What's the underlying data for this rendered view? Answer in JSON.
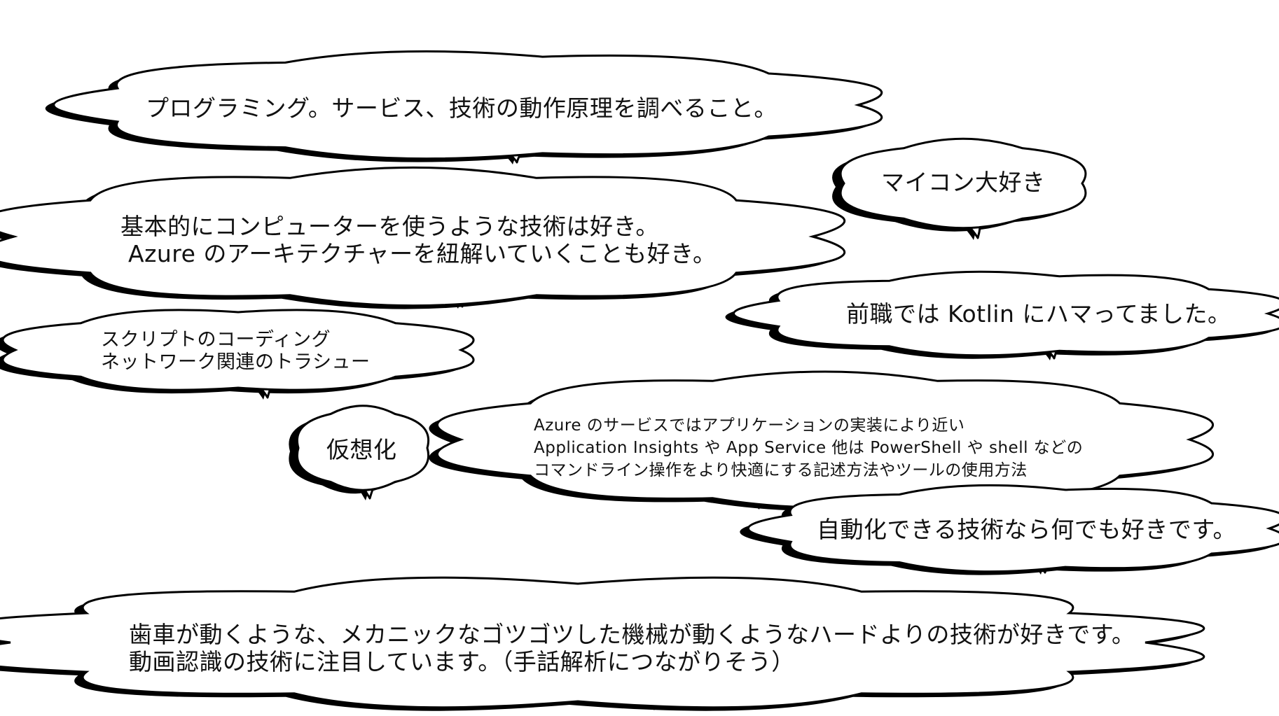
{
  "bubbles": [
    {
      "id": "programming",
      "text": "プログラミング。サービス、技術の動作原理を調べること。"
    },
    {
      "id": "microcontroller",
      "text": "マイコン大好き"
    },
    {
      "id": "computer-tech",
      "text": "基本的にコンピューターを使うような技術は好き。\n Azure のアーキテクチャーを紐解いていくことも好き。"
    },
    {
      "id": "kotlin",
      "text": "前職では Kotlin にハマってました。"
    },
    {
      "id": "scripting",
      "text": "スクリプトのコーディング\nネットワーク関連のトラシュー"
    },
    {
      "id": "virtualization",
      "text": "仮想化"
    },
    {
      "id": "azure-services",
      "text": "Azure のサービスではアプリケーションの実装により近い\nApplication Insights や App Service 他は PowerShell や shell などの\nコマンドライン操作をより快適にする記述方法やツールの使用方法"
    },
    {
      "id": "automation",
      "text": "自動化できる技術なら何でも好きです。"
    },
    {
      "id": "mechanical",
      "text": "歯車が動くような、メカニックなゴツゴツした機械が動くようなハードよりの技術が好きです。\n動画認識の技術に注目しています。（手話解析につながりそう）"
    }
  ],
  "colors": {
    "outline": "#000000",
    "fill": "#ffffff",
    "text": "#111111"
  }
}
